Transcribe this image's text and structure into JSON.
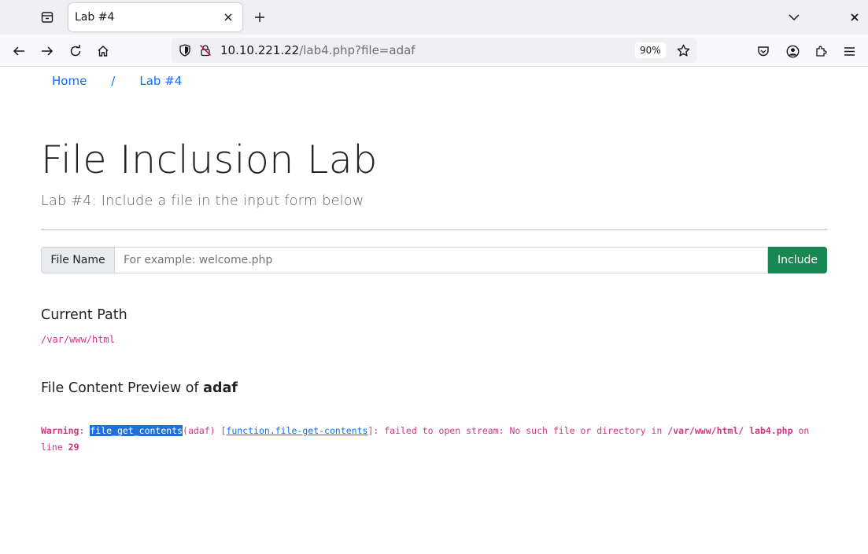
{
  "browser": {
    "tab": {
      "title": "Lab #4"
    },
    "url": {
      "host": "10.10.221.22",
      "path": "/lab4.php?file=adaf"
    },
    "zoom": "90%"
  },
  "breadcrumb": {
    "home": "Home",
    "separator": "/",
    "current": "Lab #4"
  },
  "page": {
    "title": "File Inclusion Lab",
    "subtitle": "Lab #4: Include a file in the input form below"
  },
  "form": {
    "label": "File Name",
    "placeholder": "For example: welcome.php",
    "value": "",
    "button": "Include"
  },
  "current_path": {
    "heading": "Current Path",
    "value": "/var/www/html"
  },
  "preview": {
    "heading_prefix": "File Content Preview of",
    "filename": "adaf",
    "warning": {
      "label": "Warning",
      "colon": ":",
      "function": "file_get_contents",
      "args": "(adaf) [",
      "link": "function.file-get-contents",
      "message": "]: failed to open stream: No such file or directory in",
      "file_path": "/var/www/html/ lab4.php",
      "on_line": "on line",
      "line": "29"
    }
  }
}
